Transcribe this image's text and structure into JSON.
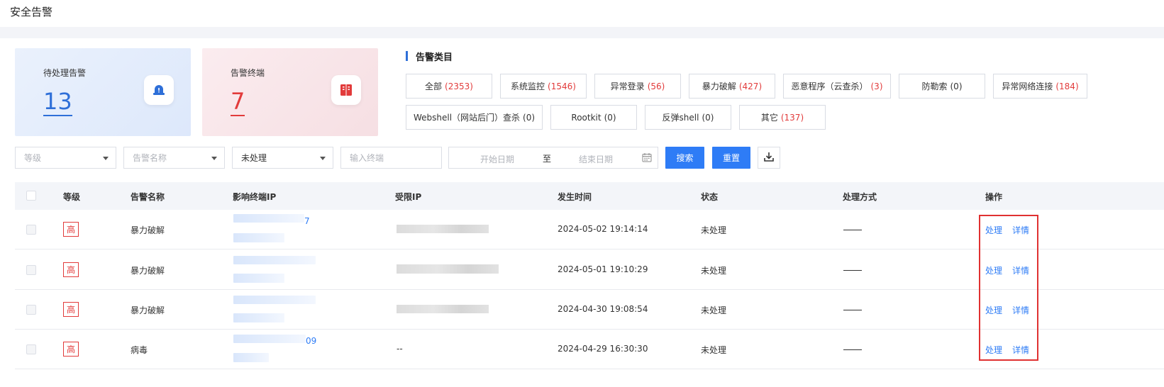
{
  "page": {
    "title": "安全告警"
  },
  "stats": {
    "pending": {
      "label": "待处理告警",
      "value": "13",
      "icon": "alarm-siren-icon",
      "color": "#2e6fd8"
    },
    "terminals": {
      "label": "告警终端",
      "value": "7",
      "icon": "server-rack-icon",
      "color": "#e23b3b"
    }
  },
  "categories": {
    "title": "告警类目",
    "items": [
      {
        "label": "全部",
        "count": "(2353)"
      },
      {
        "label": "系统监控",
        "count": "(1546)"
      },
      {
        "label": "异常登录",
        "count": "(56)"
      },
      {
        "label": "暴力破解",
        "count": "(427)"
      },
      {
        "label": "恶意程序（云查杀）",
        "count": "(3)"
      },
      {
        "label": "防勒索",
        "count": "(0)"
      },
      {
        "label": "异常网络连接",
        "count": "(184)"
      },
      {
        "label": "Webshell（网站后门）查杀",
        "count": "(0)"
      },
      {
        "label": "Rootkit",
        "count": "(0)"
      },
      {
        "label": "反弹shell",
        "count": "(0)"
      },
      {
        "label": "其它",
        "count": "(137)"
      }
    ]
  },
  "filters": {
    "level_placeholder": "等级",
    "alert_name_placeholder": "告警名称",
    "status_value": "未处理",
    "terminal_placeholder": "输入终端",
    "start_date_placeholder": "开始日期",
    "date_separator": "至",
    "end_date_placeholder": "结束日期",
    "search_label": "搜索",
    "reset_label": "重置"
  },
  "table": {
    "headers": [
      "等级",
      "告警名称",
      "影响终端IP",
      "受限IP",
      "发生时间",
      "状态",
      "处理方式",
      "操作"
    ],
    "rows": [
      {
        "level": "高",
        "name": "暴力破解",
        "ip_tail": "7",
        "restricted_ip": "",
        "time": "2024-05-02 19:14:14",
        "status": "未处理",
        "method": "——",
        "action_process": "处理",
        "action_detail": "详情"
      },
      {
        "level": "高",
        "name": "暴力破解",
        "ip_tail": "",
        "restricted_ip": "",
        "time": "2024-05-01 19:10:29",
        "status": "未处理",
        "method": "——",
        "action_process": "处理",
        "action_detail": "详情"
      },
      {
        "level": "高",
        "name": "暴力破解",
        "ip_tail": "",
        "restricted_ip": "",
        "time": "2024-04-30 19:08:54",
        "status": "未处理",
        "method": "——",
        "action_process": "处理",
        "action_detail": "详情"
      },
      {
        "level": "高",
        "name": "病毒",
        "ip_tail": "09",
        "restricted_ip": "--",
        "time": "2024-04-29 16:30:30",
        "status": "未处理",
        "method": "——",
        "action_process": "处理",
        "action_detail": "详情"
      }
    ]
  },
  "colors": {
    "primary": "#2e7cf6",
    "danger": "#e23b3b",
    "highlight": "#e03131"
  }
}
